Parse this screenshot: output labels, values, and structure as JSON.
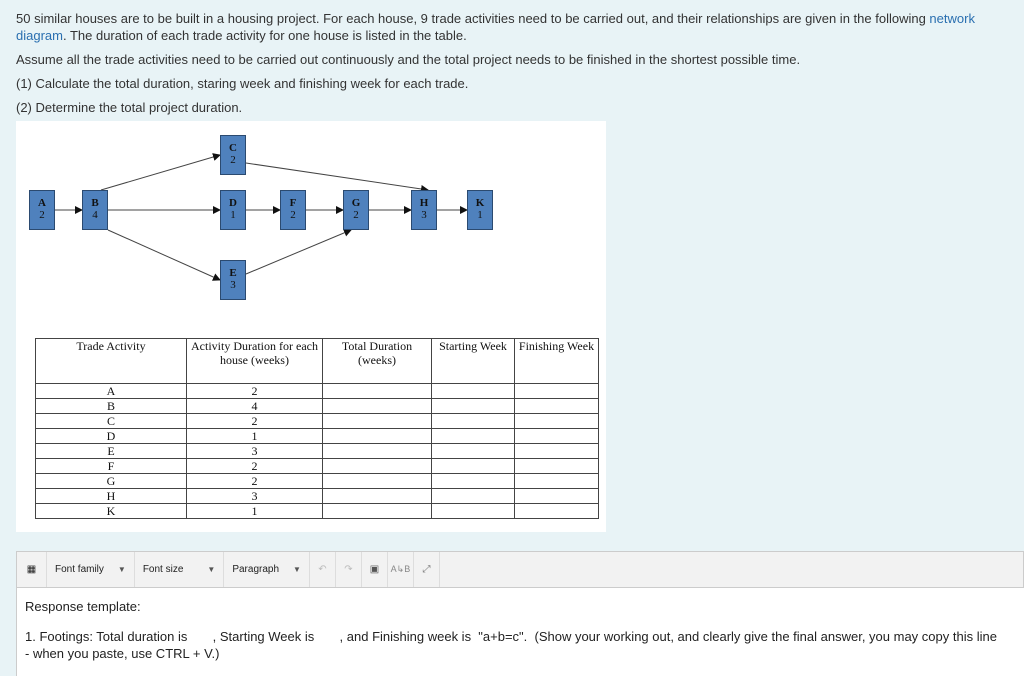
{
  "question": {
    "intro": "50 similar houses are to be built in a housing project. For each house, 9 trade activities need to be carried out, and their relationships are given in the following ",
    "link1": "network",
    "link2": "diagram",
    "intro_end": ". The duration of each trade activity for one house is listed in the table.",
    "assume": "Assume all the trade activities need to be carried out continuously and the total project needs to be finished in the shortest possible time.",
    "q1": "(1) Calculate the total duration, staring week and finishing week for each trade.",
    "q2": "(2) Determine the total project duration."
  },
  "diagram": {
    "nodes": [
      {
        "id": "A",
        "d": "2"
      },
      {
        "id": "B",
        "d": "4"
      },
      {
        "id": "C",
        "d": "2"
      },
      {
        "id": "D",
        "d": "1"
      },
      {
        "id": "E",
        "d": "3"
      },
      {
        "id": "F",
        "d": "2"
      },
      {
        "id": "G",
        "d": "2"
      },
      {
        "id": "H",
        "d": "3"
      },
      {
        "id": "K",
        "d": "1"
      }
    ],
    "edges": [
      [
        "A",
        "B"
      ],
      [
        "B",
        "C"
      ],
      [
        "B",
        "D"
      ],
      [
        "B",
        "E"
      ],
      [
        "C",
        "H"
      ],
      [
        "D",
        "F"
      ],
      [
        "F",
        "G"
      ],
      [
        "E",
        "G"
      ],
      [
        "G",
        "H"
      ],
      [
        "H",
        "K"
      ]
    ],
    "node_color": "#4f81bd"
  },
  "table": {
    "headers": [
      "Trade Activity",
      "Activity Duration for each house (weeks)",
      "Total Duration (weeks)",
      "Starting Week",
      "Finishing Week"
    ],
    "rows": [
      [
        "A",
        "2"
      ],
      [
        "B",
        "4"
      ],
      [
        "C",
        "2"
      ],
      [
        "D",
        "1"
      ],
      [
        "E",
        "3"
      ],
      [
        "F",
        "2"
      ],
      [
        "G",
        "2"
      ],
      [
        "H",
        "3"
      ],
      [
        "K",
        "1"
      ]
    ]
  },
  "toolbar": {
    "font_family": "Font family",
    "font_size": "Font size",
    "paragraph": "Paragraph",
    "icons": [
      "undo-icon",
      "redo-icon",
      "find-icon",
      "spellcheck-icon",
      "fullscreen-icon"
    ]
  },
  "editor": {
    "line1": "Response template:",
    "line2": "1. Footings: Total duration is       , Starting Week is       , and Finishing week is  \"a+b=c\".  (Show your working out, and clearly give the final answer, you may copy this line",
    "line3": "- when you paste, use CTRL + V.)"
  }
}
